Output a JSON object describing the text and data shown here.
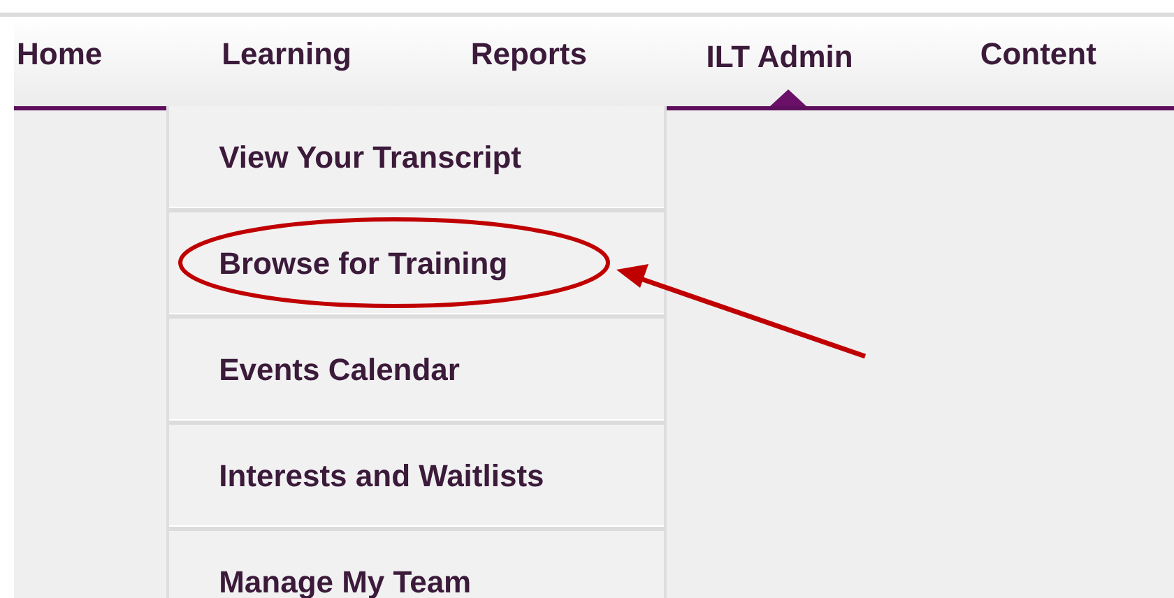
{
  "nav": {
    "tabs": [
      {
        "label": "Home",
        "selected": false
      },
      {
        "label": "Learning",
        "selected": false,
        "menu": {
          "items": [
            {
              "label": "View Your Transcript",
              "highlighted": false
            },
            {
              "label": "Browse for Training",
              "highlighted": true
            },
            {
              "label": "Events Calendar",
              "highlighted": false
            },
            {
              "label": "Interests and Waitlists",
              "highlighted": false
            },
            {
              "label": "Manage My Team",
              "highlighted": false
            }
          ]
        }
      },
      {
        "label": "Reports",
        "selected": false
      },
      {
        "label": "ILT Admin",
        "selected": true
      },
      {
        "label": "Content",
        "selected": false
      }
    ]
  }
}
